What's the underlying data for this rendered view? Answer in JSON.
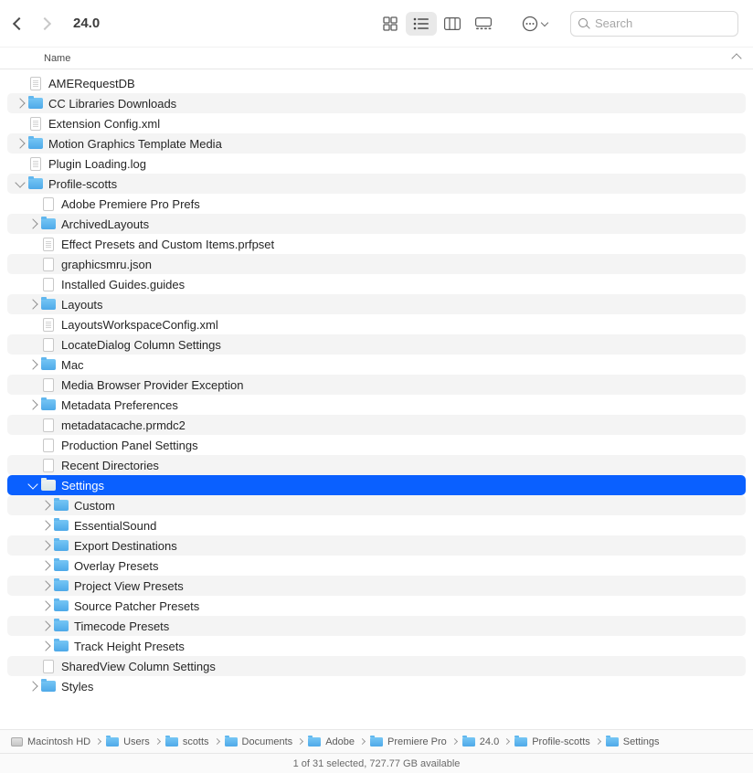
{
  "toolbar": {
    "title": "24.0",
    "search_placeholder": "Search"
  },
  "column_header": "Name",
  "items": [
    {
      "name": "AMERequestDB",
      "type": "doc",
      "level": 0,
      "disclosure": "none",
      "alt": false
    },
    {
      "name": "CC Libraries Downloads",
      "type": "folder",
      "level": 0,
      "disclosure": "closed",
      "alt": true
    },
    {
      "name": "Extension Config.xml",
      "type": "doc",
      "level": 0,
      "disclosure": "none",
      "alt": false
    },
    {
      "name": "Motion Graphics Template Media",
      "type": "folder",
      "level": 0,
      "disclosure": "closed",
      "alt": true
    },
    {
      "name": "Plugin Loading.log",
      "type": "doc",
      "level": 0,
      "disclosure": "none",
      "alt": false
    },
    {
      "name": "Profile-scotts",
      "type": "folder",
      "level": 0,
      "disclosure": "open",
      "alt": true
    },
    {
      "name": "Adobe Premiere Pro Prefs",
      "type": "blank",
      "level": 1,
      "disclosure": "none",
      "alt": false
    },
    {
      "name": "ArchivedLayouts",
      "type": "folder",
      "level": 1,
      "disclosure": "closed",
      "alt": true
    },
    {
      "name": "Effect Presets and Custom Items.prfpset",
      "type": "doc",
      "level": 1,
      "disclosure": "none",
      "alt": false
    },
    {
      "name": "graphicsmru.json",
      "type": "blank",
      "level": 1,
      "disclosure": "none",
      "alt": true
    },
    {
      "name": "Installed Guides.guides",
      "type": "blank",
      "level": 1,
      "disclosure": "none",
      "alt": false
    },
    {
      "name": "Layouts",
      "type": "folder",
      "level": 1,
      "disclosure": "closed",
      "alt": true
    },
    {
      "name": "LayoutsWorkspaceConfig.xml",
      "type": "doc",
      "level": 1,
      "disclosure": "none",
      "alt": false
    },
    {
      "name": "LocateDialog Column Settings",
      "type": "blank",
      "level": 1,
      "disclosure": "none",
      "alt": true
    },
    {
      "name": "Mac",
      "type": "folder",
      "level": 1,
      "disclosure": "closed",
      "alt": false
    },
    {
      "name": "Media Browser Provider Exception",
      "type": "blank",
      "level": 1,
      "disclosure": "none",
      "alt": true
    },
    {
      "name": "Metadata Preferences",
      "type": "folder",
      "level": 1,
      "disclosure": "closed",
      "alt": false
    },
    {
      "name": "metadatacache.prmdc2",
      "type": "blank",
      "level": 1,
      "disclosure": "none",
      "alt": true
    },
    {
      "name": "Production Panel Settings",
      "type": "blank",
      "level": 1,
      "disclosure": "none",
      "alt": false
    },
    {
      "name": "Recent Directories",
      "type": "blank",
      "level": 1,
      "disclosure": "none",
      "alt": true
    },
    {
      "name": "Settings",
      "type": "folder",
      "level": 1,
      "disclosure": "open",
      "alt": false,
      "selected": true
    },
    {
      "name": "Custom",
      "type": "folder",
      "level": 2,
      "disclosure": "closed",
      "alt": true
    },
    {
      "name": "EssentialSound",
      "type": "folder",
      "level": 2,
      "disclosure": "closed",
      "alt": false
    },
    {
      "name": "Export Destinations",
      "type": "folder",
      "level": 2,
      "disclosure": "closed",
      "alt": true
    },
    {
      "name": "Overlay Presets",
      "type": "folder",
      "level": 2,
      "disclosure": "closed",
      "alt": false
    },
    {
      "name": "Project View Presets",
      "type": "folder",
      "level": 2,
      "disclosure": "closed",
      "alt": true
    },
    {
      "name": "Source Patcher Presets",
      "type": "folder",
      "level": 2,
      "disclosure": "closed",
      "alt": false
    },
    {
      "name": "Timecode Presets",
      "type": "folder",
      "level": 2,
      "disclosure": "closed",
      "alt": true
    },
    {
      "name": "Track Height Presets",
      "type": "folder",
      "level": 2,
      "disclosure": "closed",
      "alt": false
    },
    {
      "name": "SharedView Column Settings",
      "type": "blank",
      "level": 1,
      "disclosure": "none",
      "alt": true
    },
    {
      "name": "Styles",
      "type": "folder",
      "level": 1,
      "disclosure": "closed",
      "alt": false
    }
  ],
  "path": [
    {
      "label": "Macintosh HD",
      "icon": "hd"
    },
    {
      "label": "Users",
      "icon": "folder"
    },
    {
      "label": "scotts",
      "icon": "folder"
    },
    {
      "label": "Documents",
      "icon": "folder"
    },
    {
      "label": "Adobe",
      "icon": "folder"
    },
    {
      "label": "Premiere Pro",
      "icon": "folder"
    },
    {
      "label": "24.0",
      "icon": "folder"
    },
    {
      "label": "Profile-scotts",
      "icon": "folder"
    },
    {
      "label": "Settings",
      "icon": "folder"
    }
  ],
  "status": "1 of 31 selected, 727.77 GB available"
}
